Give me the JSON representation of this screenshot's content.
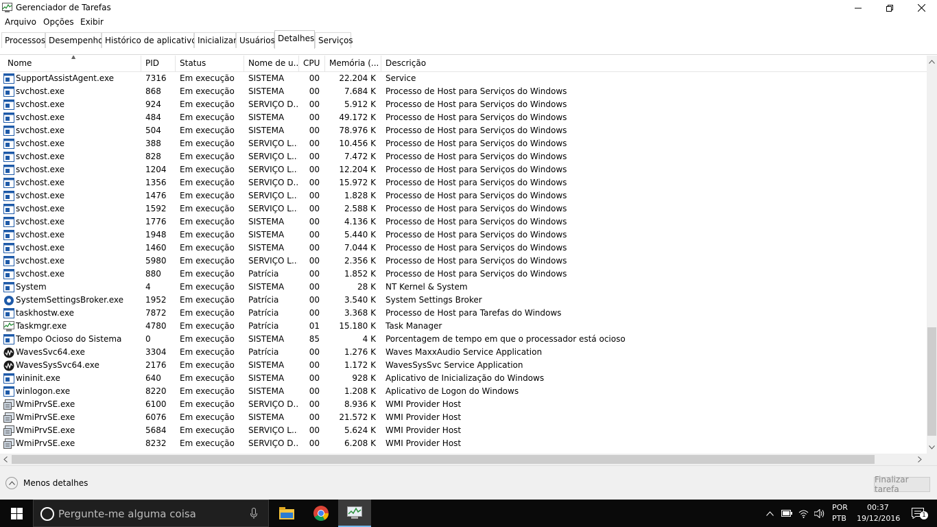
{
  "window": {
    "title": "Gerenciador de Tarefas"
  },
  "menu": [
    "Arquivo",
    "Opções",
    "Exibir"
  ],
  "tabs": [
    "Processos",
    "Desempenho",
    "Histórico de aplicativos",
    "Inicializar",
    "Usuários",
    "Detalhes",
    "Serviços"
  ],
  "active_tab": "Detalhes",
  "columns": {
    "name": "Nome",
    "pid": "PID",
    "status": "Status",
    "user": "Nome de u...",
    "cpu": "CPU",
    "mem": "Memória (...",
    "desc": "Descrição"
  },
  "rows": [
    {
      "icon": "service-icon",
      "name": "SupportAssistAgent.exe",
      "pid": "7316",
      "status": "Em execução",
      "user": "SISTEMA",
      "cpu": "00",
      "mem": "22.204 K",
      "desc": "Service"
    },
    {
      "icon": "service-icon",
      "name": "svchost.exe",
      "pid": "868",
      "status": "Em execução",
      "user": "SISTEMA",
      "cpu": "00",
      "mem": "7.684 K",
      "desc": "Processo de Host para Serviços do Windows"
    },
    {
      "icon": "service-icon",
      "name": "svchost.exe",
      "pid": "924",
      "status": "Em execução",
      "user": "SERVIÇO D...",
      "cpu": "00",
      "mem": "5.912 K",
      "desc": "Processo de Host para Serviços do Windows"
    },
    {
      "icon": "service-icon",
      "name": "svchost.exe",
      "pid": "484",
      "status": "Em execução",
      "user": "SISTEMA",
      "cpu": "00",
      "mem": "49.172 K",
      "desc": "Processo de Host para Serviços do Windows"
    },
    {
      "icon": "service-icon",
      "name": "svchost.exe",
      "pid": "504",
      "status": "Em execução",
      "user": "SISTEMA",
      "cpu": "00",
      "mem": "78.976 K",
      "desc": "Processo de Host para Serviços do Windows"
    },
    {
      "icon": "service-icon",
      "name": "svchost.exe",
      "pid": "388",
      "status": "Em execução",
      "user": "SERVIÇO L...",
      "cpu": "00",
      "mem": "10.456 K",
      "desc": "Processo de Host para Serviços do Windows"
    },
    {
      "icon": "service-icon",
      "name": "svchost.exe",
      "pid": "828",
      "status": "Em execução",
      "user": "SERVIÇO L...",
      "cpu": "00",
      "mem": "7.472 K",
      "desc": "Processo de Host para Serviços do Windows"
    },
    {
      "icon": "service-icon",
      "name": "svchost.exe",
      "pid": "1204",
      "status": "Em execução",
      "user": "SERVIÇO L...",
      "cpu": "00",
      "mem": "12.204 K",
      "desc": "Processo de Host para Serviços do Windows"
    },
    {
      "icon": "service-icon",
      "name": "svchost.exe",
      "pid": "1356",
      "status": "Em execução",
      "user": "SERVIÇO D...",
      "cpu": "00",
      "mem": "15.972 K",
      "desc": "Processo de Host para Serviços do Windows"
    },
    {
      "icon": "service-icon",
      "name": "svchost.exe",
      "pid": "1476",
      "status": "Em execução",
      "user": "SERVIÇO L...",
      "cpu": "00",
      "mem": "1.828 K",
      "desc": "Processo de Host para Serviços do Windows"
    },
    {
      "icon": "service-icon",
      "name": "svchost.exe",
      "pid": "1592",
      "status": "Em execução",
      "user": "SERVIÇO L...",
      "cpu": "00",
      "mem": "2.588 K",
      "desc": "Processo de Host para Serviços do Windows"
    },
    {
      "icon": "service-icon",
      "name": "svchost.exe",
      "pid": "1776",
      "status": "Em execução",
      "user": "SISTEMA",
      "cpu": "00",
      "mem": "4.136 K",
      "desc": "Processo de Host para Serviços do Windows"
    },
    {
      "icon": "service-icon",
      "name": "svchost.exe",
      "pid": "1948",
      "status": "Em execução",
      "user": "SISTEMA",
      "cpu": "00",
      "mem": "5.440 K",
      "desc": "Processo de Host para Serviços do Windows"
    },
    {
      "icon": "service-icon",
      "name": "svchost.exe",
      "pid": "1460",
      "status": "Em execução",
      "user": "SISTEMA",
      "cpu": "00",
      "mem": "7.044 K",
      "desc": "Processo de Host para Serviços do Windows"
    },
    {
      "icon": "service-icon",
      "name": "svchost.exe",
      "pid": "5980",
      "status": "Em execução",
      "user": "SERVIÇO L...",
      "cpu": "00",
      "mem": "2.356 K",
      "desc": "Processo de Host para Serviços do Windows"
    },
    {
      "icon": "service-icon",
      "name": "svchost.exe",
      "pid": "880",
      "status": "Em execução",
      "user": "Patrícia",
      "cpu": "00",
      "mem": "1.852 K",
      "desc": "Processo de Host para Serviços do Windows"
    },
    {
      "icon": "service-icon",
      "name": "System",
      "pid": "4",
      "status": "Em execução",
      "user": "SISTEMA",
      "cpu": "00",
      "mem": "28 K",
      "desc": "NT Kernel & System"
    },
    {
      "icon": "gear-icon",
      "name": "SystemSettingsBroker.exe",
      "pid": "1952",
      "status": "Em execução",
      "user": "Patrícia",
      "cpu": "00",
      "mem": "3.540 K",
      "desc": "System Settings Broker"
    },
    {
      "icon": "service-icon",
      "name": "taskhostw.exe",
      "pid": "7872",
      "status": "Em execução",
      "user": "Patrícia",
      "cpu": "00",
      "mem": "3.368 K",
      "desc": "Processo de Host para Tarefas do Windows"
    },
    {
      "icon": "taskmgr-icon",
      "name": "Taskmgr.exe",
      "pid": "4780",
      "status": "Em execução",
      "user": "Patrícia",
      "cpu": "01",
      "mem": "15.180 K",
      "desc": "Task Manager"
    },
    {
      "icon": "service-icon",
      "name": "Tempo Ocioso do Sistema",
      "pid": "0",
      "status": "Em execução",
      "user": "SISTEMA",
      "cpu": "85",
      "mem": "4 K",
      "desc": "Porcentagem de tempo em que o processador está ocioso"
    },
    {
      "icon": "waves-icon",
      "name": "WavesSvc64.exe",
      "pid": "3304",
      "status": "Em execução",
      "user": "Patrícia",
      "cpu": "00",
      "mem": "1.276 K",
      "desc": "Waves MaxxAudio Service Application"
    },
    {
      "icon": "waves-icon",
      "name": "WavesSysSvc64.exe",
      "pid": "2176",
      "status": "Em execução",
      "user": "SISTEMA",
      "cpu": "00",
      "mem": "1.172 K",
      "desc": "WavesSysSvc Service Application"
    },
    {
      "icon": "service-icon",
      "name": "wininit.exe",
      "pid": "640",
      "status": "Em execução",
      "user": "SISTEMA",
      "cpu": "00",
      "mem": "928 K",
      "desc": "Aplicativo de Inicialização do Windows"
    },
    {
      "icon": "service-icon",
      "name": "winlogon.exe",
      "pid": "8220",
      "status": "Em execução",
      "user": "SISTEMA",
      "cpu": "00",
      "mem": "1.208 K",
      "desc": "Aplicativo de Logon do Windows"
    },
    {
      "icon": "wmi-icon",
      "name": "WmiPrvSE.exe",
      "pid": "6100",
      "status": "Em execução",
      "user": "SERVIÇO D...",
      "cpu": "00",
      "mem": "8.936 K",
      "desc": "WMI Provider Host"
    },
    {
      "icon": "wmi-icon",
      "name": "WmiPrvSE.exe",
      "pid": "6076",
      "status": "Em execução",
      "user": "SISTEMA",
      "cpu": "00",
      "mem": "21.572 K",
      "desc": "WMI Provider Host"
    },
    {
      "icon": "wmi-icon",
      "name": "WmiPrvSE.exe",
      "pid": "5684",
      "status": "Em execução",
      "user": "SERVIÇO L...",
      "cpu": "00",
      "mem": "5.624 K",
      "desc": "WMI Provider Host"
    },
    {
      "icon": "wmi-icon",
      "name": "WmiPrvSE.exe",
      "pid": "8232",
      "status": "Em execução",
      "user": "SERVIÇO D...",
      "cpu": "00",
      "mem": "6.208 K",
      "desc": "WMI Provider Host"
    }
  ],
  "footer": {
    "less_details": "Menos detalhes",
    "end_task": "Finalizar tarefa"
  },
  "taskbar": {
    "search_placeholder": "Pergunte-me alguma coisa",
    "apps": [
      "file-explorer-icon",
      "chrome-icon",
      "task-manager-icon"
    ],
    "lang_top": "POR",
    "lang_bottom": "PTB",
    "time": "00:37",
    "date": "19/12/2016",
    "notifications": "1"
  },
  "colors": {
    "taskbar": "#0a0a0a",
    "active_indicator": "#76b9ed",
    "icon_blue": "#1e5aa8"
  }
}
